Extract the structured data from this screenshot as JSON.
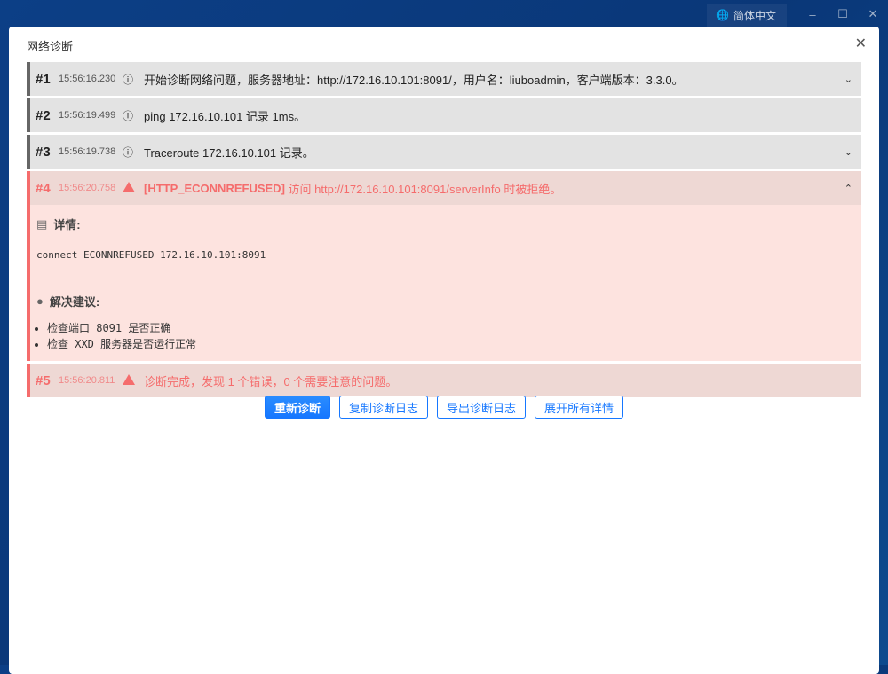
{
  "topbar": {
    "language": "简体中文",
    "minimize": "–",
    "maximize": "☐",
    "close": "✕"
  },
  "dialog": {
    "title": "网络诊断",
    "close": "✕"
  },
  "entries": [
    {
      "num": "#1",
      "time": "15:56:16.230",
      "text": "开始诊断网络问题，服务器地址：http://172.16.10.101:8091/，用户名：liuboadmin，客户端版本：3.3.0。",
      "level": "info",
      "chevron": "⌄"
    },
    {
      "num": "#2",
      "time": "15:56:19.499",
      "text": "ping 172.16.10.101 记录 1ms。",
      "level": "info"
    },
    {
      "num": "#3",
      "time": "15:56:19.738",
      "text": "Traceroute 172.16.10.101 记录。",
      "level": "info",
      "chevron": "⌄"
    },
    {
      "num": "#4",
      "time": "15:56:20.758",
      "code": "[HTTP_ECONNREFUSED]",
      "text": "访问 http://172.16.10.101:8091/serverInfo 时被拒绝。",
      "level": "error",
      "chevron": "⌃",
      "details_label": "详情:",
      "details": "connect ECONNREFUSED 172.16.10.101:8091",
      "suggest_label": "解决建议:",
      "suggestions": [
        "检查端口 8091 是否正确",
        "检查 XXD 服务器是否运行正常"
      ]
    },
    {
      "num": "#5",
      "time": "15:56:20.811",
      "text": "诊断完成，发现 1 个错误，0 个需要注意的问题。",
      "level": "error"
    }
  ],
  "buttons": {
    "rediagnose": "重新诊断",
    "copy": "复制诊断日志",
    "export": "导出诊断日志",
    "expand": "展开所有详情"
  }
}
